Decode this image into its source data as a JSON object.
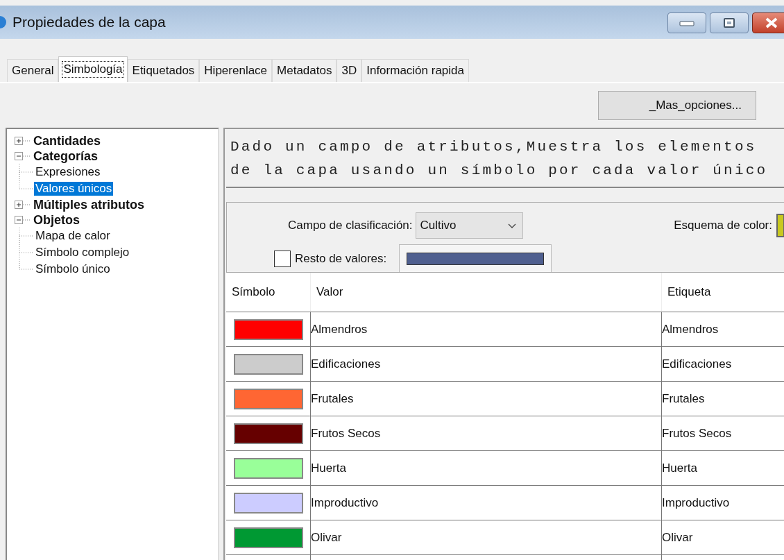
{
  "window": {
    "title": "Propiedades de la capa"
  },
  "tabs": [
    {
      "label": "General",
      "selected": false
    },
    {
      "label": "Simbología",
      "selected": true
    },
    {
      "label": "Etiquetados",
      "selected": false
    },
    {
      "label": "Hiperenlace",
      "selected": false
    },
    {
      "label": "Metadatos",
      "selected": false
    },
    {
      "label": "3D",
      "selected": false
    },
    {
      "label": "Información rapida",
      "selected": false
    }
  ],
  "more_options_button": "_Mas_opciones...",
  "tree": [
    {
      "label": "Cantidades",
      "expanded": false,
      "selected": false
    },
    {
      "label": "Categorías",
      "expanded": true,
      "selected": false,
      "children": [
        {
          "label": "Expresiones",
          "selected": false
        },
        {
          "label": "Valores únicos",
          "selected": true
        }
      ]
    },
    {
      "label": "Múltiples atributos",
      "expanded": false,
      "selected": false
    },
    {
      "label": "Objetos",
      "expanded": true,
      "selected": false,
      "children": [
        {
          "label": "Mapa de calor",
          "selected": false
        },
        {
          "label": "Símbolo complejo",
          "selected": false
        },
        {
          "label": "Símbolo único",
          "selected": false
        }
      ]
    }
  ],
  "description": "Dado un campo de atributos,Muestra los elementos de la capa usando un símbolo por cada valor único",
  "classification_field": {
    "label": "Campo de clasificación:",
    "value": "Cultivo"
  },
  "color_scheme": {
    "label": "Esquema de color:"
  },
  "rest_values": {
    "label": "Resto de valores:",
    "checked": false,
    "color": "#4f5f8f"
  },
  "table": {
    "columns": [
      "Símbolo",
      "Valor",
      "Etiqueta"
    ],
    "rows": [
      {
        "color": "#ff0000",
        "value": "Almendros",
        "label": "Almendros"
      },
      {
        "color": "#cccccc",
        "value": "Edificaciones",
        "label": "Edificaciones"
      },
      {
        "color": "#ff6633",
        "value": "Frutales",
        "label": "Frutales"
      },
      {
        "color": "#660000",
        "value": "Frutos Secos",
        "label": "Frutos Secos"
      },
      {
        "color": "#99ff99",
        "value": "Huerta",
        "label": "Huerta"
      },
      {
        "color": "#ccccff",
        "value": "Improductivo",
        "label": "Improductivo"
      },
      {
        "color": "#009933",
        "value": "Olivar",
        "label": "Olivar"
      }
    ]
  }
}
